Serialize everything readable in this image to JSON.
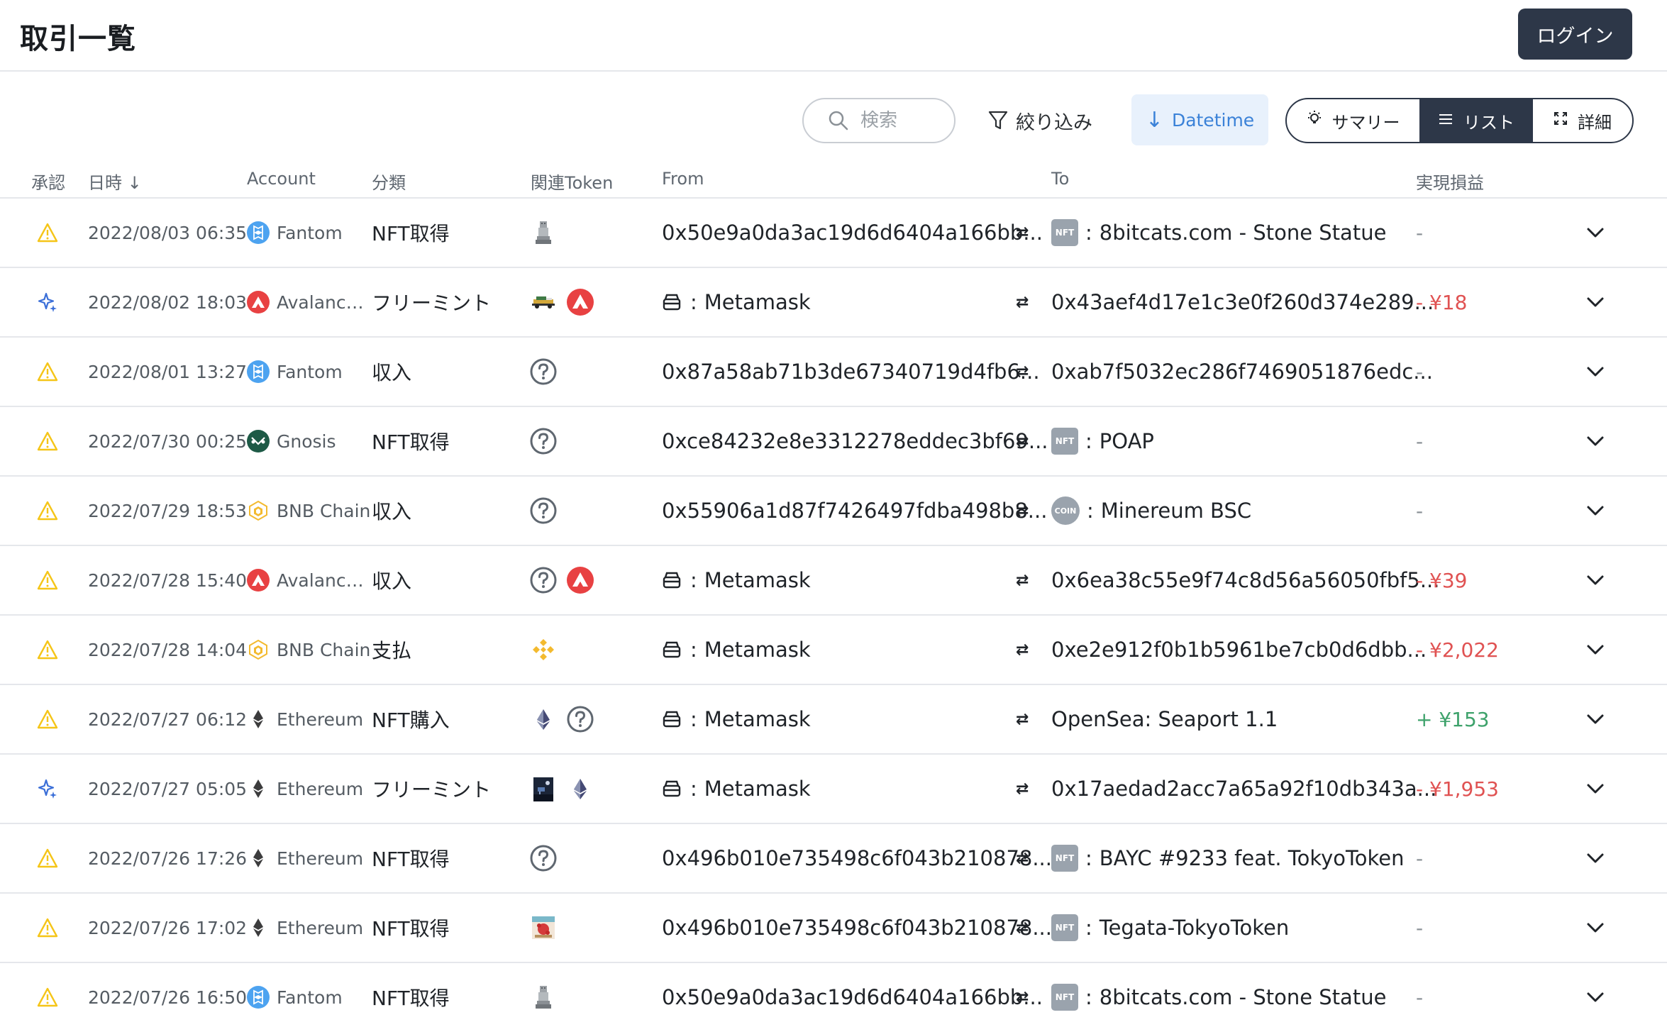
{
  "header": {
    "title": "取引一覧",
    "login_label": "ログイン"
  },
  "toolbar": {
    "search_placeholder": "検索",
    "filter_label": "絞り込み",
    "sort_label": "Datetime",
    "views": [
      {
        "label": "サマリー",
        "icon": "lightbulb-icon",
        "active": false
      },
      {
        "label": "リスト",
        "icon": "list-icon",
        "active": true
      },
      {
        "label": "詳細",
        "icon": "expand-icon",
        "active": false
      }
    ]
  },
  "columns": {
    "status": "承認",
    "date": "日時 ↓",
    "account": "Account",
    "category": "分類",
    "tokens": "関連Token",
    "from": "From",
    "to": "To",
    "pnl": "実現損益"
  },
  "colors": {
    "accent": "#3b82d8",
    "dark": "#2d3748",
    "warning": "#f5c518",
    "negative": "#e05252",
    "positive": "#3ea26b"
  },
  "rows": [
    {
      "status": "warning",
      "date": "2022/08/03 06:35",
      "account": "Fantom",
      "chain": "fantom",
      "category": "NFT取得",
      "tokens": [
        "statue-nft-icon"
      ],
      "from": "0x50e9a0da3ac19d6d6404a166bb...",
      "from_type": "address",
      "to": "8bitcats.com - Stone Statue",
      "to_prefix": "NFT",
      "to_type": "nft",
      "pnl": "-",
      "pnl_type": "none"
    },
    {
      "status": "mint",
      "date": "2022/08/02 18:03",
      "account": "Avalanche...",
      "chain": "avalanche",
      "category": "フリーミント",
      "tokens": [
        "car-nft-icon",
        "avalanche-icon"
      ],
      "from": "Metamask",
      "from_type": "wallet",
      "to": "0x43aef4d17e1c3e0f260d374e289...",
      "to_prefix": "",
      "to_type": "address",
      "pnl": "- ¥18",
      "pnl_type": "neg"
    },
    {
      "status": "warning",
      "date": "2022/08/01 13:27",
      "account": "Fantom",
      "chain": "fantom",
      "category": "収入",
      "tokens": [
        "unknown-token-icon"
      ],
      "from": "0x87a58ab71b3de67340719d4fb6...",
      "from_type": "address",
      "to": "0xab7f5032ec286f7469051876edc...",
      "to_prefix": "",
      "to_type": "address",
      "pnl": "-",
      "pnl_type": "none"
    },
    {
      "status": "warning",
      "date": "2022/07/30 00:25",
      "account": "Gnosis",
      "chain": "gnosis",
      "category": "NFT取得",
      "tokens": [
        "unknown-token-icon"
      ],
      "from": "0xce84232e8e3312278eddec3bf69...",
      "from_type": "address",
      "to": "POAP",
      "to_prefix": "NFT",
      "to_type": "nft",
      "pnl": "-",
      "pnl_type": "none"
    },
    {
      "status": "warning",
      "date": "2022/07/29 18:53",
      "account": "BNB Chain",
      "chain": "bnb",
      "category": "収入",
      "tokens": [
        "unknown-token-icon"
      ],
      "from": "0x55906a1d87f7426497fdba498b8...",
      "from_type": "address",
      "to": "Minereum BSC",
      "to_prefix": "COIN",
      "to_type": "coin",
      "pnl": "-",
      "pnl_type": "none"
    },
    {
      "status": "warning",
      "date": "2022/07/28 15:40",
      "account": "Avalanche...",
      "chain": "avalanche",
      "category": "収入",
      "tokens": [
        "unknown-token-icon",
        "avalanche-icon"
      ],
      "from": "Metamask",
      "from_type": "wallet",
      "to": "0x6ea38c55e9f74c8d56a56050fbf5...",
      "to_prefix": "",
      "to_type": "address",
      "pnl": "- ¥39",
      "pnl_type": "neg"
    },
    {
      "status": "warning",
      "date": "2022/07/28 14:04",
      "account": "BNB Chain",
      "chain": "bnb",
      "category": "支払",
      "tokens": [
        "bnb-icon"
      ],
      "from": "Metamask",
      "from_type": "wallet",
      "to": "0xe2e912f0b1b5961be7cb0d6dbb...",
      "to_prefix": "",
      "to_type": "address",
      "pnl": "- ¥2,022",
      "pnl_type": "neg"
    },
    {
      "status": "warning",
      "date": "2022/07/27 06:12",
      "account": "Ethereum",
      "chain": "ethereum",
      "category": "NFT購入",
      "tokens": [
        "ethereum-icon",
        "unknown-token-icon"
      ],
      "from": "Metamask",
      "from_type": "wallet",
      "to": "OpenSea: Seaport 1.1",
      "to_prefix": "",
      "to_type": "address",
      "pnl": "+ ¥153",
      "pnl_type": "pos"
    },
    {
      "status": "mint",
      "date": "2022/07/27 05:05",
      "account": "Ethereum",
      "chain": "ethereum",
      "category": "フリーミント",
      "tokens": [
        "night-nft-icon",
        "ethereum-icon"
      ],
      "from": "Metamask",
      "from_type": "wallet",
      "to": "0x17aedad2acc7a65a92f10db343a...",
      "to_prefix": "",
      "to_type": "address",
      "pnl": "- ¥1,953",
      "pnl_type": "neg"
    },
    {
      "status": "warning",
      "date": "2022/07/26 17:26",
      "account": "Ethereum",
      "chain": "ethereum",
      "category": "NFT取得",
      "tokens": [
        "unknown-token-icon"
      ],
      "from": "0x496b010e735498c6f043b210878...",
      "from_type": "address",
      "to": "BAYC #9233 feat. TokyoToken",
      "to_prefix": "NFT",
      "to_type": "nft",
      "pnl": "-",
      "pnl_type": "none"
    },
    {
      "status": "warning",
      "date": "2022/07/26 17:02",
      "account": "Ethereum",
      "chain": "ethereum",
      "category": "NFT取得",
      "tokens": [
        "tegata-nft-icon"
      ],
      "from": "0x496b010e735498c6f043b210878...",
      "from_type": "address",
      "to": "Tegata-TokyoToken",
      "to_prefix": "NFT",
      "to_type": "nft",
      "pnl": "-",
      "pnl_type": "none"
    },
    {
      "status": "warning",
      "date": "2022/07/26 16:50",
      "account": "Fantom",
      "chain": "fantom",
      "category": "NFT取得",
      "tokens": [
        "statue-nft-icon"
      ],
      "from": "0x50e9a0da3ac19d6d6404a166bb...",
      "from_type": "address",
      "to": "8bitcats.com - Stone Statue",
      "to_prefix": "NFT",
      "to_type": "nft",
      "pnl": "-",
      "pnl_type": "none"
    }
  ]
}
